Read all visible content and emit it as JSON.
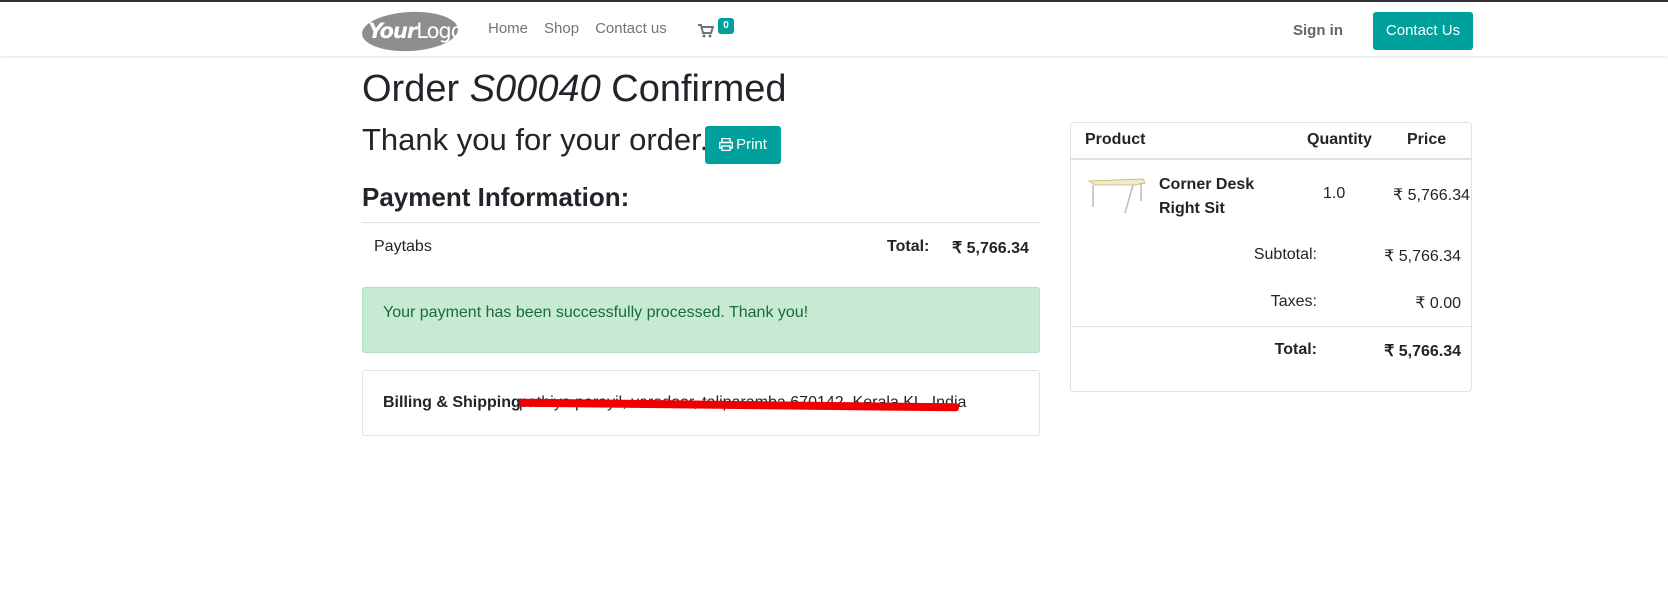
{
  "nav": {
    "logo_text": "YourLogo",
    "links": [
      "Home",
      "Shop",
      "Contact us"
    ],
    "cart_count": "0",
    "signin_label": "Sign in",
    "contact_label": "Contact Us"
  },
  "order": {
    "title_prefix": "Order ",
    "order_id": "S00040",
    "title_suffix": " Confirmed",
    "thanks": "Thank you for your order.",
    "print_label": "Print"
  },
  "payment": {
    "heading": "Payment Information:",
    "method": "Paytabs",
    "total_label": "Total:",
    "total_value": "₹ 5,766.34",
    "success_message": "Your payment has been successfully processed. Thank you!"
  },
  "billing": {
    "label": "Billing & Shipping:",
    "address": "pathiya parayil, varadoor, taliparamba 670142, Kerala KL, India"
  },
  "summary": {
    "headers": {
      "product": "Product",
      "quantity": "Quantity",
      "price": "Price"
    },
    "item": {
      "name": "Corner Desk Right Sit",
      "quantity": "1.0",
      "price": "₹ 5,766.34"
    },
    "subtotal_label": "Subtotal:",
    "subtotal_value": "₹ 5,766.34",
    "taxes_label": "Taxes:",
    "taxes_value": "₹ 0.00",
    "total_label": "Total:",
    "total_value": "₹ 5,766.34"
  },
  "colors": {
    "primary": "#00a09d",
    "success_bg": "#c6ead2",
    "success_text": "#1a6b34"
  },
  "icons": [
    "cart-icon",
    "print-icon"
  ]
}
